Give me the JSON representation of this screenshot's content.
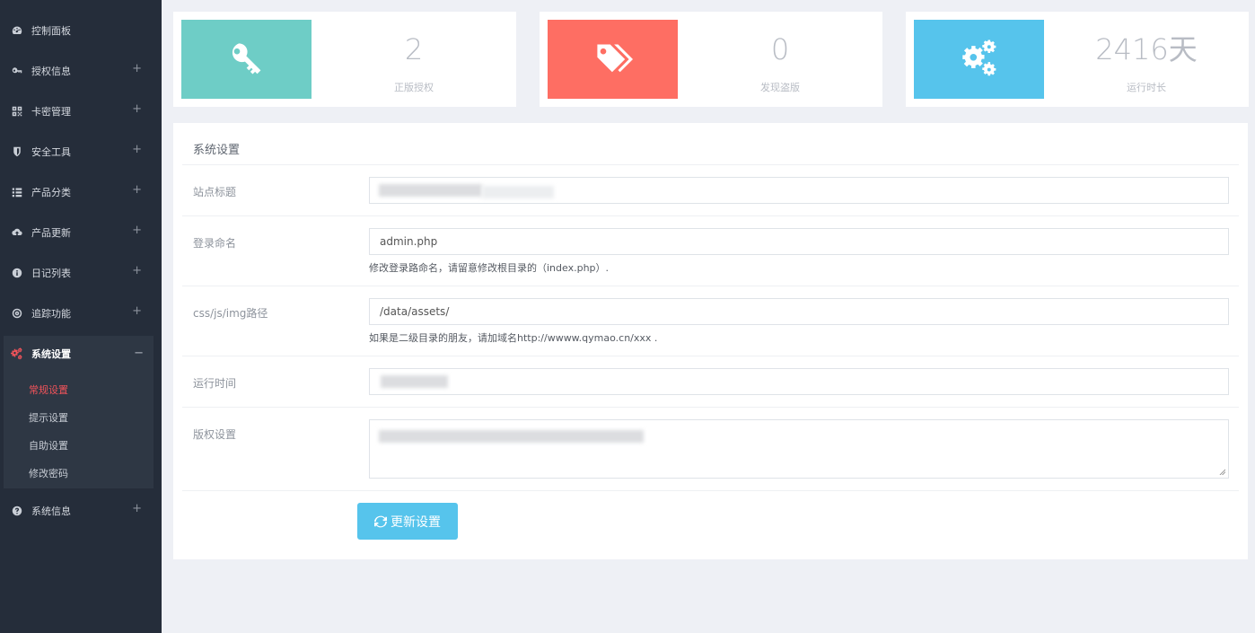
{
  "sidebar": {
    "items": [
      {
        "label": "控制面板",
        "icon": "dashboard-icon",
        "expandable": false
      },
      {
        "label": "授权信息",
        "icon": "key-icon",
        "expandable": true
      },
      {
        "label": "卡密管理",
        "icon": "qrcode-icon",
        "expandable": true
      },
      {
        "label": "安全工具",
        "icon": "shield-icon",
        "expandable": true
      },
      {
        "label": "产品分类",
        "icon": "list-icon",
        "expandable": true
      },
      {
        "label": "产品更新",
        "icon": "cloud-upload-icon",
        "expandable": true
      },
      {
        "label": "日记列表",
        "icon": "info-icon",
        "expandable": true
      },
      {
        "label": "追踪功能",
        "icon": "target-icon",
        "expandable": true
      }
    ],
    "system_settings": {
      "label": "系统设置",
      "icon": "cogs-icon",
      "toggle": "−",
      "sub_items": [
        {
          "label": "常规设置",
          "active": true
        },
        {
          "label": "提示设置",
          "active": false
        },
        {
          "label": "自助设置",
          "active": false
        },
        {
          "label": "修改密码",
          "active": false
        }
      ]
    },
    "system_info": {
      "label": "系统信息",
      "icon": "question-icon",
      "toggle": "+"
    },
    "expand_symbol": "+"
  },
  "stats": [
    {
      "value": "2",
      "label": "正版授权",
      "color": "#6ecdc6",
      "icon": "key-icon"
    },
    {
      "value": "0",
      "label": "发现盗版",
      "color": "#fe6e63",
      "icon": "tags-icon"
    },
    {
      "value": "2416天",
      "label": "运行时长",
      "color": "#56c4ec",
      "icon": "cogs-icon"
    }
  ],
  "settings": {
    "title": "系统设置",
    "fields": {
      "site_title": {
        "label": "站点标题",
        "value": ""
      },
      "login_name": {
        "label": "登录命名",
        "value": "admin.php",
        "help": "修改登录路命名，请留意修改根目录的（index.php）."
      },
      "asset_path": {
        "label": "css/js/img路径",
        "value": "/data/assets/",
        "help": "如果是二级目录的朋友，请加域名http://wwww.qymao.cn/xxx ."
      },
      "run_time": {
        "label": "运行时间",
        "value": ""
      },
      "copyright": {
        "label": "版权设置",
        "value": ""
      }
    },
    "submit_label": "更新设置"
  },
  "colors": {
    "sidebar_bg": "#252d3a",
    "accent_red": "#f0535a",
    "button_blue": "#56c4ec",
    "page_bg": "#eef0f5"
  }
}
